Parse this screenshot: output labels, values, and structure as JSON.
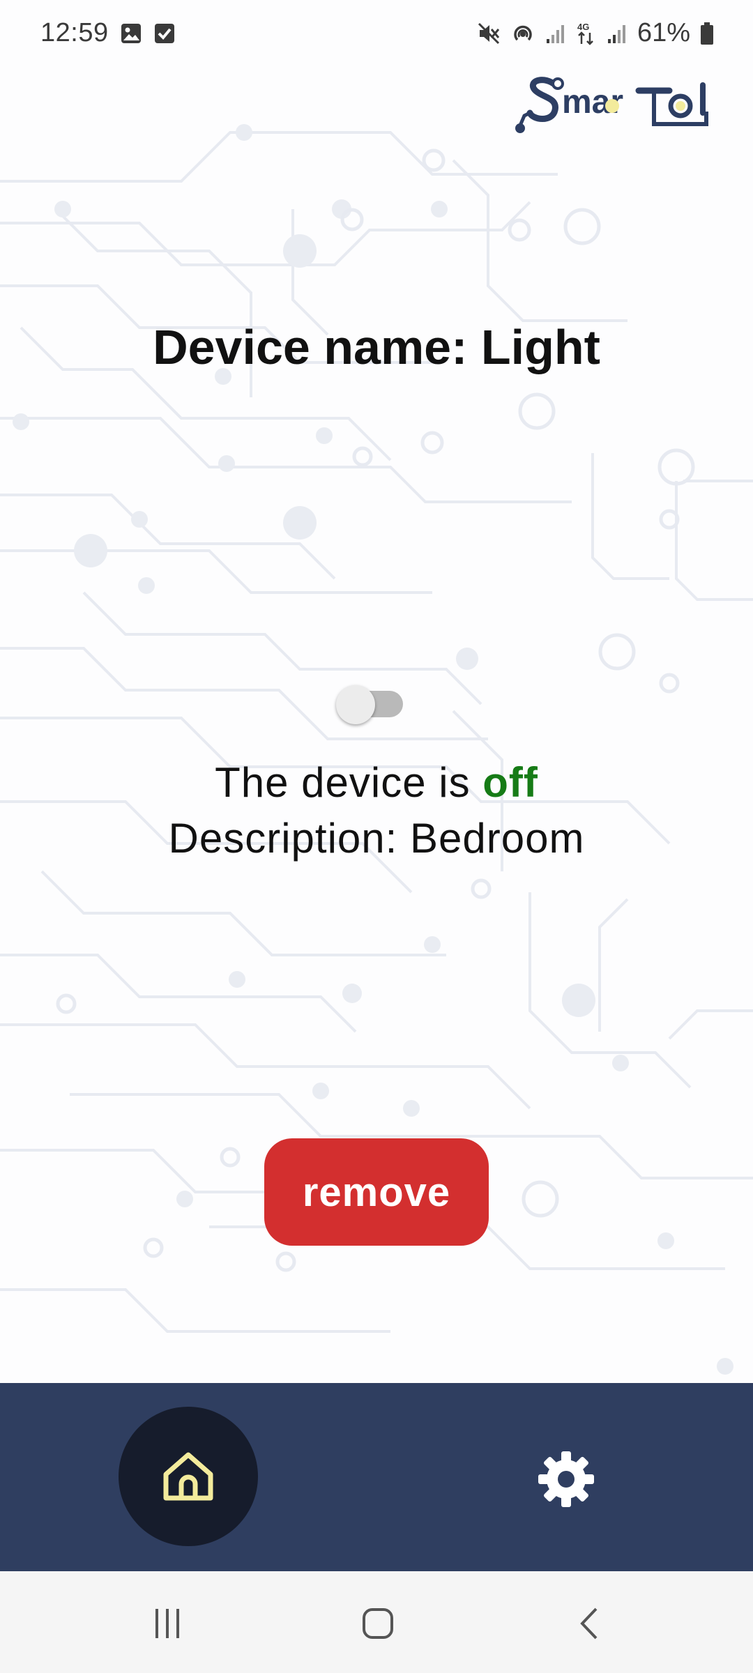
{
  "status_bar": {
    "time": "12:59",
    "battery_percent": "61%",
    "left_icons": [
      "image-notification-icon",
      "checkbox-notification-icon"
    ],
    "right_icons": [
      "mute-icon",
      "hotspot-icon",
      "signal-icon",
      "4g-data-icon",
      "signal-icon",
      "battery-icon"
    ]
  },
  "logo": {
    "text": "SmarTol"
  },
  "device": {
    "title": "Device name: Light",
    "status_prefix": "The device is ",
    "status_value": "off",
    "description": "Description: Bedroom",
    "toggle_on": false
  },
  "actions": {
    "remove_label": "remove"
  },
  "bottom_nav": {
    "items": [
      {
        "icon": "home-icon",
        "active": true
      },
      {
        "icon": "gear-icon",
        "active": false
      }
    ]
  },
  "system_nav": {
    "items": [
      "recent-apps-icon",
      "home-circle-icon",
      "back-icon"
    ]
  },
  "colors": {
    "accent_red": "#d32f2f",
    "status_green": "#167b16",
    "nav_bar": "#2f3e60",
    "nav_active": "#161c2c",
    "home_icon": "#f3eb9c",
    "logo_blue": "#2d3e63",
    "logo_yellow": "#f3eb9c"
  }
}
